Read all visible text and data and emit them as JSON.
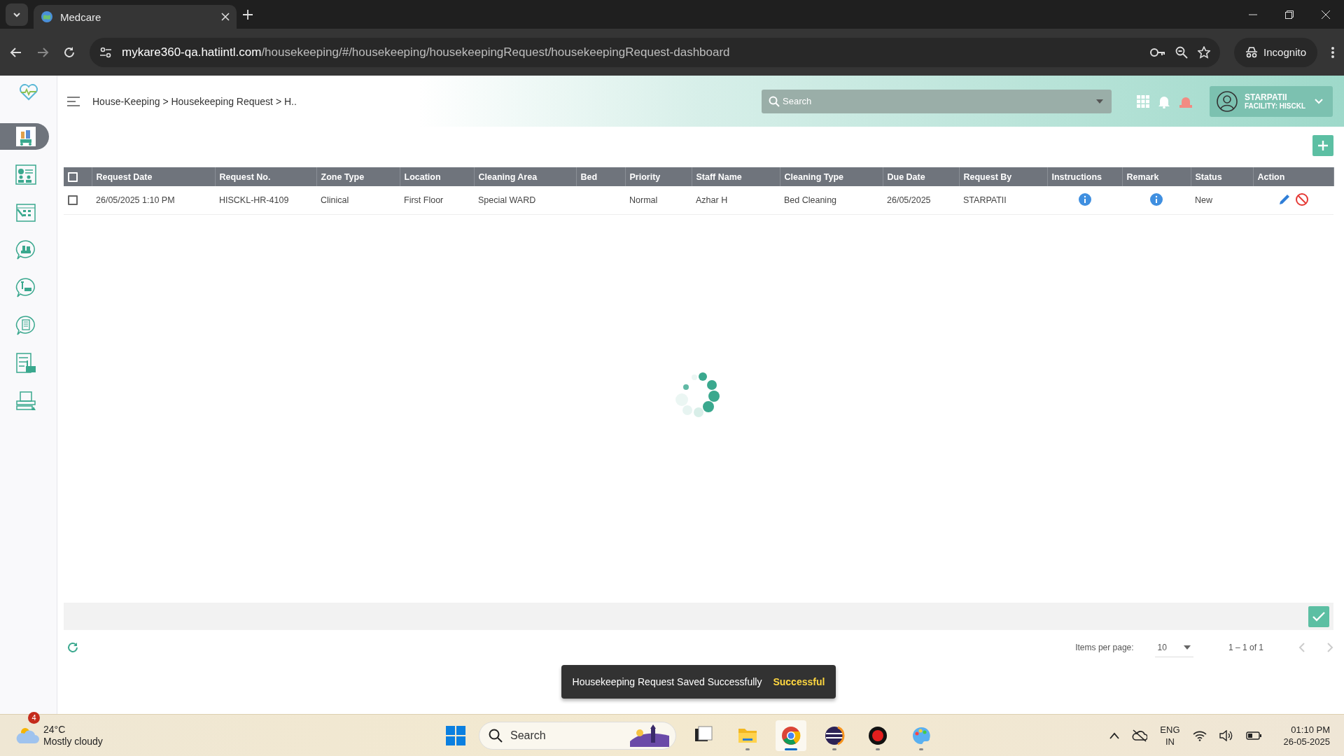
{
  "browser": {
    "tab_title": "Medcare",
    "url_host": "mykare360-qa.hatiintl.com",
    "url_path": "/housekeeping/#/housekeeping/housekeepingRequest/housekeepingRequest-dashboard",
    "profile": "Incognito"
  },
  "header": {
    "breadcrumb": "House-Keeping > Housekeeping Request > H..",
    "search": {
      "placeholder": "Search"
    },
    "user": {
      "name": "STARPATII",
      "facility": "FACILITY: HISCKL"
    }
  },
  "sidebar": {
    "items": [
      {
        "kind": "cart",
        "selected": true
      },
      {
        "kind": "dashboard",
        "selected": false
      },
      {
        "kind": "calendar",
        "selected": false
      },
      {
        "kind": "chat-cart",
        "selected": false
      },
      {
        "kind": "chat-tools",
        "selected": false
      },
      {
        "kind": "chat-list",
        "selected": false
      },
      {
        "kind": "checklist",
        "selected": false
      },
      {
        "kind": "printer",
        "selected": false
      }
    ]
  },
  "table": {
    "select_all": {
      "checked": false
    },
    "columns": [
      {
        "label": "Request Date",
        "kind": "text"
      },
      {
        "label": "Request No.",
        "kind": "text"
      },
      {
        "label": "Zone Type",
        "kind": "text"
      },
      {
        "label": "Location",
        "kind": "text"
      },
      {
        "label": "Cleaning Area",
        "kind": "text"
      },
      {
        "label": "Bed",
        "kind": "text"
      },
      {
        "label": "Priority",
        "kind": "text"
      },
      {
        "label": "Staff Name",
        "kind": "text"
      },
      {
        "label": "Cleaning Type",
        "kind": "text"
      },
      {
        "label": "Due Date",
        "kind": "text"
      },
      {
        "label": "Request By",
        "kind": "text"
      },
      {
        "label": "Instructions",
        "kind": "info"
      },
      {
        "label": "Remark",
        "kind": "info"
      },
      {
        "label": "Status",
        "kind": "text"
      },
      {
        "label": "Action",
        "kind": "actions"
      }
    ],
    "rows": [
      {
        "checked": false,
        "cells": [
          "26/05/2025 1:10 PM",
          "HISCKL-HR-4109",
          "Clinical",
          "First Floor",
          "Special WARD",
          "",
          "Normal",
          "Azhar H",
          "Bed Cleaning",
          "26/05/2025",
          "STARPATII",
          "",
          "",
          "New",
          ""
        ]
      }
    ]
  },
  "paginator": {
    "label": "Items per page:",
    "page_size": "10",
    "range": "1 – 1 of 1"
  },
  "toast": {
    "message": "Housekeeping Request Saved Successfully",
    "action": "Successful"
  },
  "taskbar": {
    "weather": {
      "badge": "4",
      "temperature": "24°C",
      "condition": "Mostly cloudy"
    },
    "search": {
      "placeholder": "Search"
    },
    "apps": [
      {
        "kind": "taskview",
        "running": false,
        "active": false
      },
      {
        "kind": "files",
        "running": true,
        "active": false
      },
      {
        "kind": "chrome",
        "running": true,
        "active": true
      },
      {
        "kind": "eclipse",
        "running": true,
        "active": false
      },
      {
        "kind": "recorder",
        "running": true,
        "active": false
      },
      {
        "kind": "paint",
        "running": true,
        "active": false
      }
    ],
    "language": "ENG",
    "region": "IN",
    "time": "01:10 PM",
    "date": "26-05-2025"
  }
}
